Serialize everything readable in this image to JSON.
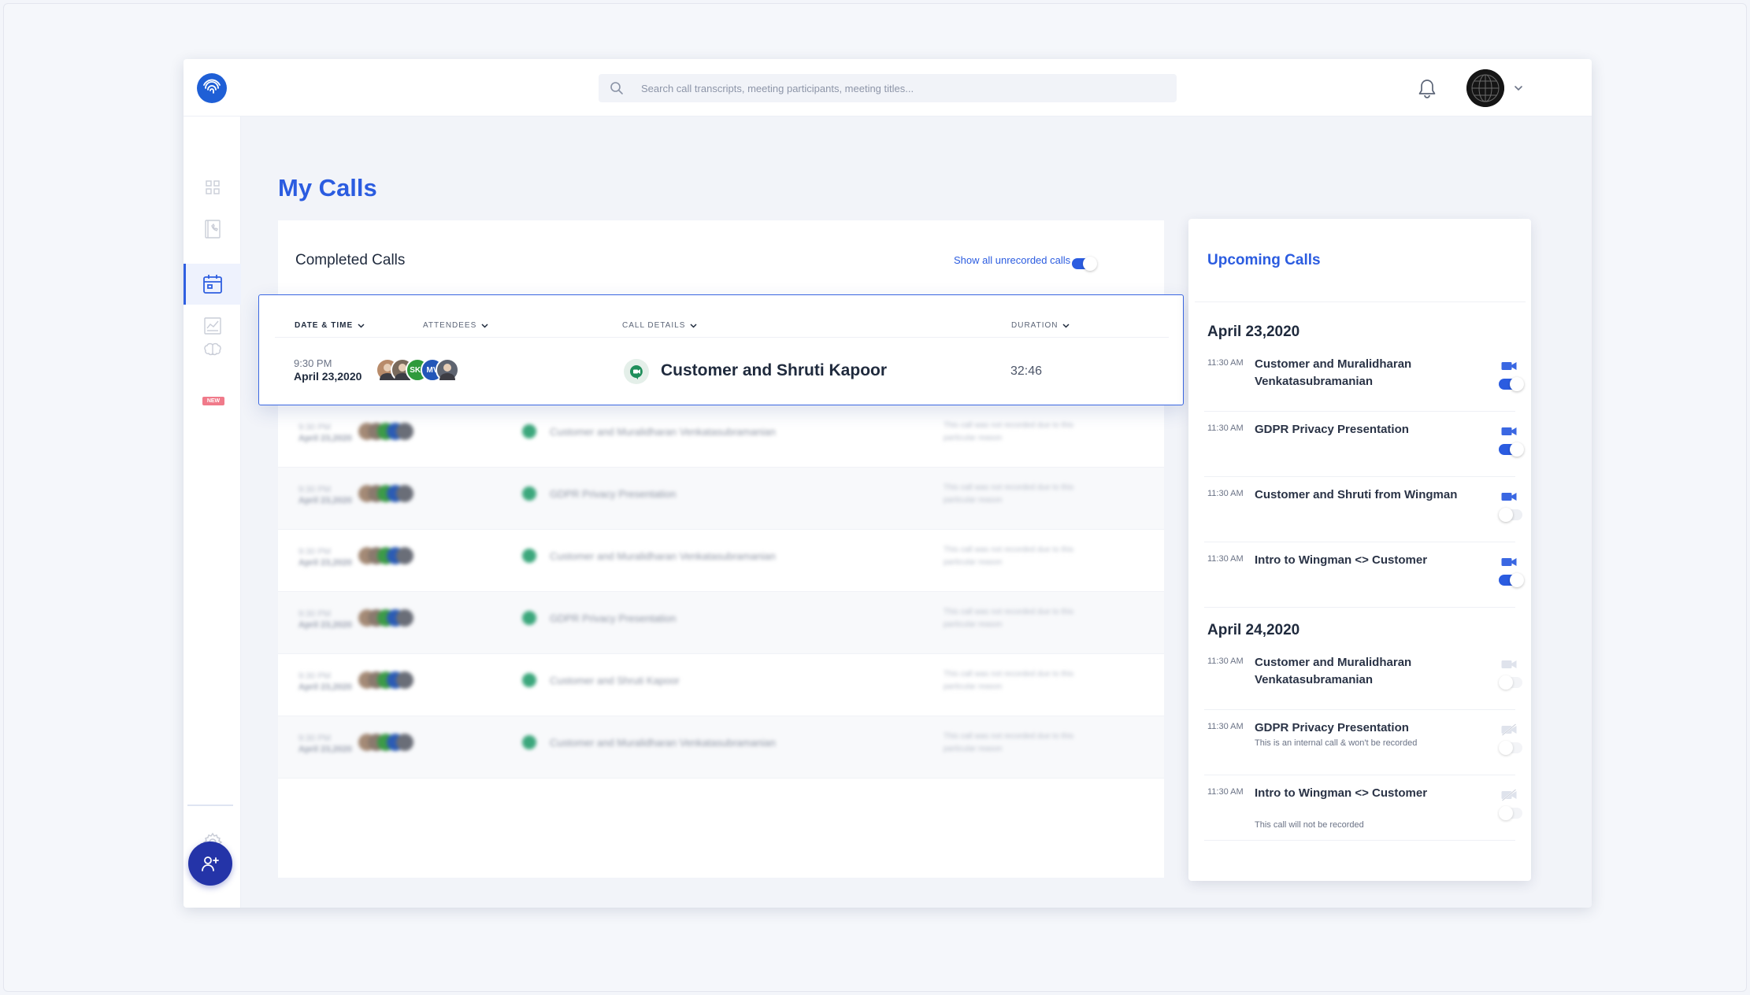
{
  "search": {
    "placeholder": "Search call transcripts, meeting participants, meeting titles..."
  },
  "page": {
    "title": "My Calls"
  },
  "sidebar": {
    "items": [
      {
        "name": "dashboard",
        "icon": "grid-icon"
      },
      {
        "name": "calls",
        "icon": "phone-book-icon"
      },
      {
        "name": "analytics",
        "icon": "bar-chart-icon"
      },
      {
        "name": "my-calls",
        "icon": "calendar-icon",
        "active": true
      },
      {
        "name": "reports",
        "icon": "report-chart-icon"
      },
      {
        "name": "library",
        "icon": "brain-icon",
        "badge": "NEW"
      }
    ],
    "settings_icon": "gear-icon",
    "invite_icon": "add-user-icon"
  },
  "completed": {
    "title": "Completed Calls",
    "show_unrecorded_label": "Show all unrecorded calls",
    "show_unrecorded_on": true,
    "columns": [
      "DATE & TIME",
      "ATTENDEES",
      "CALL DETAILS",
      "DURATION"
    ],
    "highlight_row": {
      "time": "9:30 PM",
      "date": "April 23,2020",
      "attendees": [
        {
          "type": "photo",
          "color": "#b88b6a"
        },
        {
          "type": "photo",
          "color": "#7a6a5c"
        },
        {
          "type": "initials",
          "text": "SKJ",
          "color": "#2f9a3c"
        },
        {
          "type": "initials",
          "text": "MV",
          "color": "#2356b8"
        },
        {
          "type": "photo",
          "color": "#5e6470"
        }
      ],
      "title": "Customer and Shruti Kapoor",
      "duration": "32:46"
    },
    "blurred_rows": [
      {
        "time": "9:30 PM",
        "date": "April 23,2020",
        "title": "Customer and Muralidharan Venkatasubramanian",
        "note": "This call was not recorded due to this particular reason"
      },
      {
        "time": "9:30 PM",
        "date": "April 23,2020",
        "title": "GDPR Privacy Presentation",
        "note": "This call was not recorded due to this particular reason"
      },
      {
        "time": "9:30 PM",
        "date": "April 23,2020",
        "title": "Customer and Muralidharan Venkatasubramanian",
        "note": "This call was not recorded due to this particular reason"
      },
      {
        "time": "9:30 PM",
        "date": "April 23,2020",
        "title": "GDPR Privacy Presentation",
        "note": "This call was not recorded due to this particular reason"
      },
      {
        "time": "9:30 PM",
        "date": "April 23,2020",
        "title": "Customer and Shruti Kapoor",
        "note": "This call was not recorded due to this particular reason"
      },
      {
        "time": "9:30 PM",
        "date": "April 23,2020",
        "title": "Customer and Muralidharan Venkatasubramanian",
        "note": "This call was not recorded due to this particular reason"
      }
    ]
  },
  "upcoming": {
    "title": "Upcoming Calls",
    "groups": [
      {
        "date": "April 23,2020",
        "items": [
          {
            "time": "11:30 AM",
            "name": "Customer and Muralidharan Venkatasubramanian",
            "recording": true,
            "camera": "active"
          },
          {
            "time": "11:30 AM",
            "name": "GDPR Privacy Presentation",
            "recording": true,
            "camera": "active"
          },
          {
            "time": "11:30 AM",
            "name": "Customer and Shruti from Wingman",
            "recording": false,
            "camera": "active"
          },
          {
            "time": "11:30 AM",
            "name": "Intro to Wingman <> Customer",
            "recording": true,
            "camera": "active"
          }
        ]
      },
      {
        "date": "April 24,2020",
        "items": [
          {
            "time": "11:30 AM",
            "name": "Customer and Muralidharan Venkatasubramanian",
            "recording": false,
            "camera": "faded"
          },
          {
            "time": "11:30 AM",
            "name": "GDPR Privacy Presentation",
            "note": "This is an internal call & won't be recorded",
            "recording": false,
            "camera": "disabled"
          },
          {
            "time": "11:30 AM",
            "name": "Intro to Wingman <> Customer",
            "note": "This call will not be recorded",
            "recording": false,
            "camera": "disabled"
          }
        ]
      }
    ]
  },
  "colors": {
    "accent": "#2b5ce0",
    "invite": "#2434a8",
    "brand": "#1f5fd6"
  }
}
